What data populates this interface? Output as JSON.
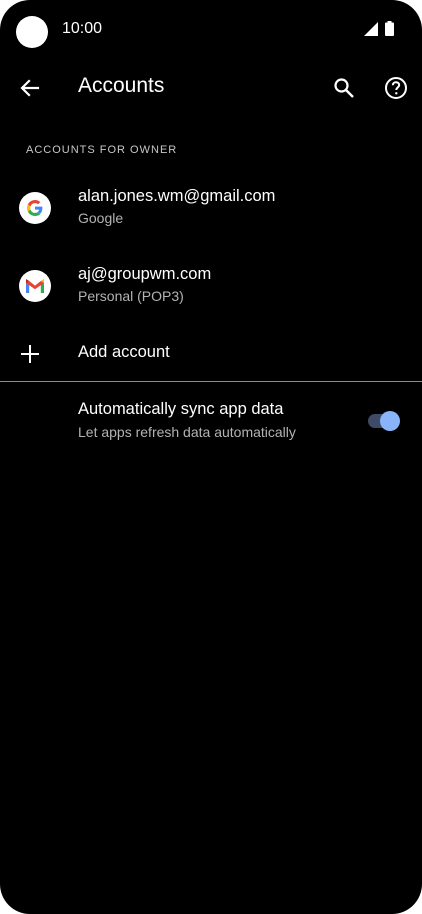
{
  "status_bar": {
    "time": "10:00",
    "icons": [
      "camera-cutout",
      "signal-icon",
      "battery-icon"
    ]
  },
  "app_bar": {
    "title": "Accounts",
    "icons": [
      "back-arrow-icon",
      "search-icon",
      "help-icon"
    ]
  },
  "section": {
    "header": "ACCOUNTS FOR OWNER"
  },
  "accounts": [
    {
      "email": "alan.jones.wm@gmail.com",
      "type": "Google",
      "icon": "google-icon"
    },
    {
      "email": "aj@groupwm.com",
      "type": "Personal (POP3)",
      "icon": "gmail-icon"
    }
  ],
  "add_account": {
    "label": "Add account",
    "icon": "plus-icon"
  },
  "auto_sync": {
    "title": "Automatically sync app data",
    "subtitle": "Let apps refresh data automatically",
    "enabled": true
  },
  "colors": {
    "background": "#000000",
    "text_primary": "#ffffff",
    "text_secondary": "#b3b3b3",
    "toggle_thumb": "#8ab4f8",
    "toggle_track": "#3e4a66",
    "google_blue": "#4285F4",
    "google_red": "#EA4335",
    "google_yellow": "#FBBC05",
    "google_green": "#34A853"
  }
}
